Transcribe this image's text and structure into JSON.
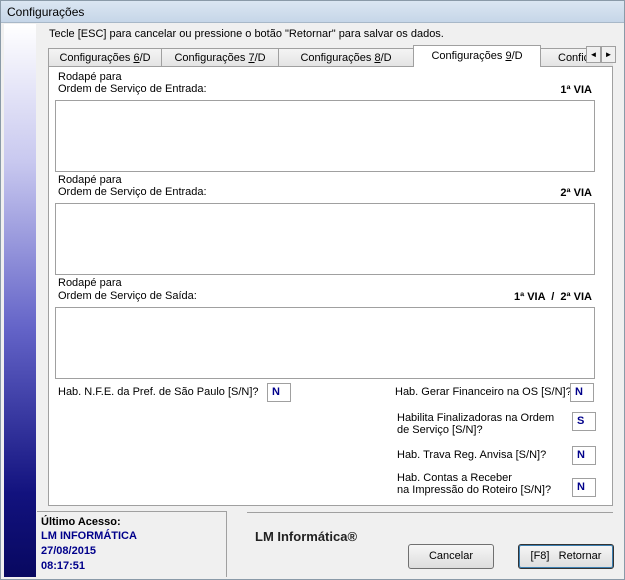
{
  "window": {
    "title": "Configurações"
  },
  "hint": "Tecle [ESC] para cancelar ou pressione o botão \"Retornar\" para salvar os dados.",
  "tabs": [
    {
      "label_pre": "Configurações ",
      "label_ul": "6",
      "label_post": "/D"
    },
    {
      "label_pre": "Configurações ",
      "label_ul": "7",
      "label_post": "/D"
    },
    {
      "label_pre": "Configurações ",
      "label_ul": "8",
      "label_post": "/D"
    },
    {
      "label_pre": "Configurações ",
      "label_ul": "9",
      "label_post": "/D"
    },
    {
      "label_pre": "Confic",
      "label_ul": "",
      "label_post": ""
    }
  ],
  "tab_scroll": {
    "left": "◄",
    "right": "►"
  },
  "footers": [
    {
      "line1": "Rodapé para",
      "line2": "Ordem de Serviço de Entrada:",
      "via": "1ª VIA"
    },
    {
      "line1": "Rodapé para",
      "line2": "Ordem de Serviço de Entrada:",
      "via": "2ª VIA"
    },
    {
      "line1": "Rodapé para",
      "line2": "Ordem de Serviço de Saída:",
      "via": "1ª VIA  /  2ª VIA"
    }
  ],
  "fields": {
    "nfe": {
      "label": "Hab. N.F.E. da Pref. de São Paulo [S/N]?",
      "value": "N"
    },
    "financeiro": {
      "label": "Hab. Gerar Financeiro na OS [S/N]?",
      "value": "N"
    },
    "finalizadoras": {
      "line1": "Habilita Finalizadoras na Ordem",
      "line2": "de Serviço [S/N]?",
      "value": "S"
    },
    "anvisa": {
      "label": "Hab. Trava Reg. Anvisa [S/N]?",
      "value": "N"
    },
    "contas": {
      "line1": "Hab. Contas a Receber",
      "line2": "na Impressão do Roteiro [S/N]?",
      "value": "N"
    }
  },
  "access": {
    "title": "Último Acesso:",
    "company": "LM INFORMÁTICA",
    "date": "27/08/2015",
    "time": "08:17:51"
  },
  "brand": "LM Informática®",
  "buttons": {
    "cancel": "Cancelar",
    "return_key": "[F8]",
    "return_label": "Retornar"
  }
}
